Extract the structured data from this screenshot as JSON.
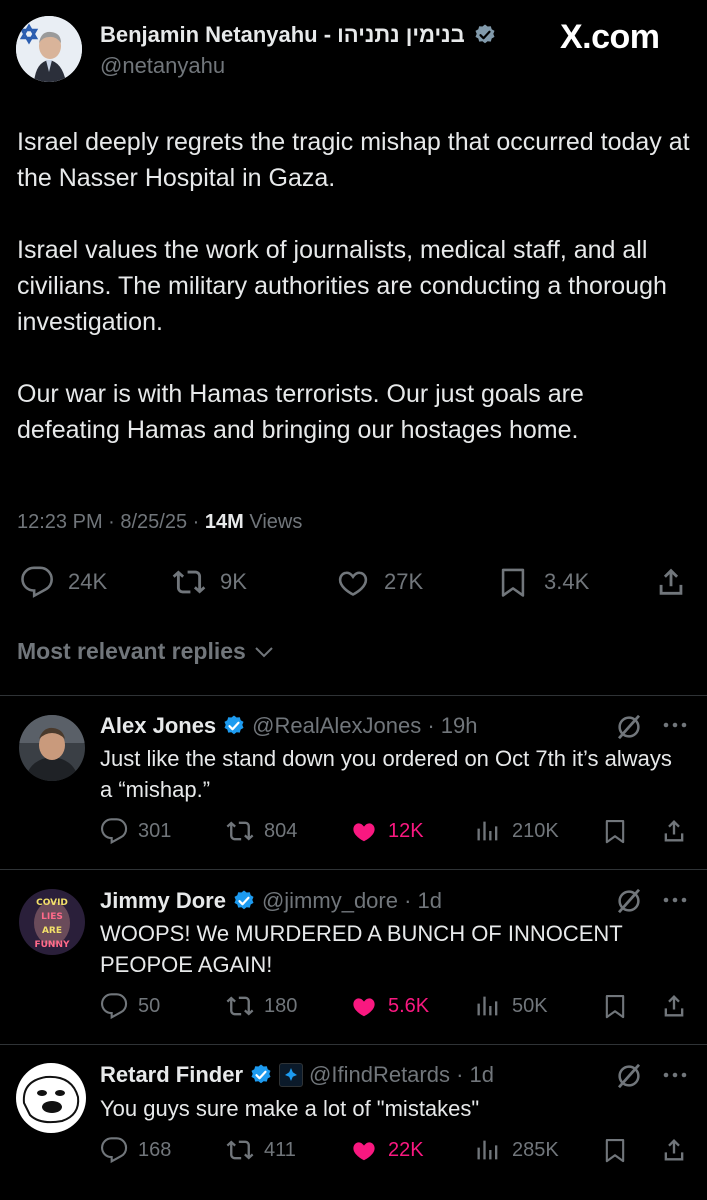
{
  "brand": {
    "label": "X.com"
  },
  "post": {
    "author_name": "Benjamin Netanyahu - בנימין נתניהו",
    "author_handle": "@netanyahu",
    "text": "Israel deeply regrets the tragic mishap that occurred today at the Nasser Hospital in Gaza.\n\nIsrael values the work of journalists, medical staff, and all civilians. The military authorities are conducting a thorough investigation.\n\nOur war is with Hamas terrorists. Our just goals are defeating Hamas and bringing our hostages home.",
    "timestamp": "12:23 PM · 8/25/25 · ",
    "views_count": "14M",
    "views_label": " Views",
    "stats": {
      "replies": "24K",
      "reposts": "9K",
      "likes": "27K",
      "bookmarks": "3.4K"
    }
  },
  "replies_header": {
    "label": "Most relevant replies"
  },
  "replies": [
    {
      "name": "Alex Jones",
      "handle": "@RealAlexJones · 19h",
      "text": "Just like the stand down you ordered on Oct 7th it’s always a “mishap.”",
      "stats": {
        "replies": "301",
        "reposts": "804",
        "likes": "12K",
        "views": "210K"
      }
    },
    {
      "name": "Jimmy Dore",
      "handle": "@jimmy_dore · 1d",
      "text": "WOOPS!  We MURDERED A BUNCH OF INNOCENT PEOPOE AGAIN!",
      "stats": {
        "replies": "50",
        "reposts": "180",
        "likes": "5.6K",
        "views": "50K"
      }
    },
    {
      "name": "Retard Finder",
      "handle": "@IfindRetards · 1d",
      "text": "You guys sure make a lot of \"mistakes\"",
      "stats": {
        "replies": "168",
        "reposts": "411",
        "likes": "22K",
        "views": "285K"
      }
    }
  ],
  "avatar_texts": {
    "jimmy_dore": [
      "COVID",
      "LIES",
      "ARE",
      "FUNNY"
    ]
  },
  "colors": {
    "background": "#000000",
    "text": "#e7e9ea",
    "muted": "#71767b",
    "like": "#f91880",
    "verified": "#1d9bf0",
    "divider": "#2f3336"
  }
}
